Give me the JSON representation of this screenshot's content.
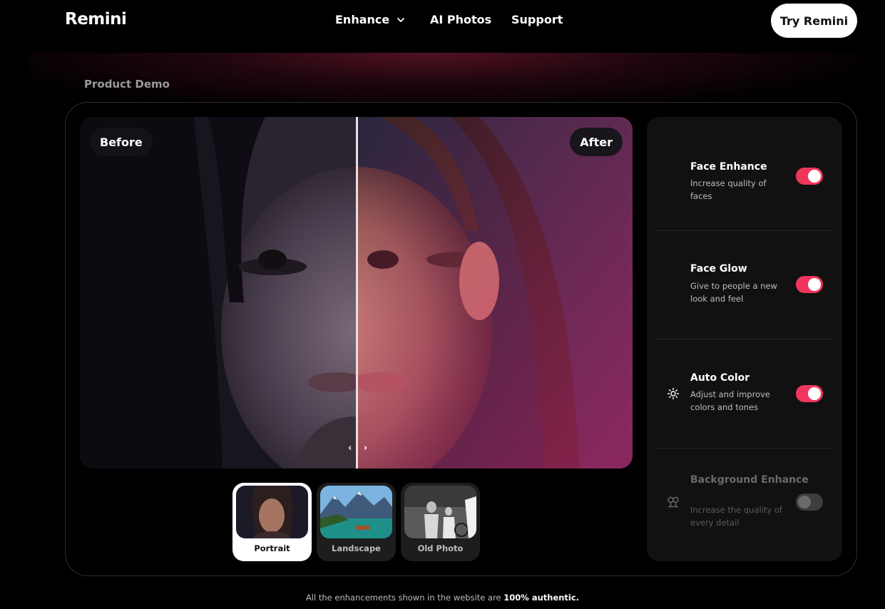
{
  "header": {
    "logo": "Remini",
    "nav": [
      {
        "label": "Enhance",
        "has_dropdown": true
      },
      {
        "label": "AI Photos"
      },
      {
        "label": "Support"
      }
    ],
    "cta": "Try Remini"
  },
  "section_title": "Product Demo",
  "viewer": {
    "before_label": "Before",
    "after_label": "After",
    "handle": "‹ ›"
  },
  "samples": [
    {
      "label": "Portrait",
      "selected": true
    },
    {
      "label": "Landscape",
      "selected": false
    },
    {
      "label": "Old Photo",
      "selected": false
    }
  ],
  "options": [
    {
      "title": "Face Enhance",
      "description": "Increase quality of faces",
      "enabled": true,
      "icon": "face-enhance-icon"
    },
    {
      "title": "Face Glow",
      "description": "Give to people a new look and feel",
      "enabled": true,
      "icon": "face-glow-icon"
    },
    {
      "title": "Auto Color",
      "description": "Adjust and improve colors and tones",
      "enabled": true,
      "icon": "sun-icon"
    },
    {
      "title": "Background Enhance",
      "description": "Increase the quality of every detail",
      "enabled": false,
      "icon": "trees-icon"
    }
  ],
  "footnote": {
    "text": "All the enhancements shown in the website are ",
    "emphasis": "100% authentic."
  },
  "colors": {
    "accent": "#f0365d",
    "background": "#000000",
    "panel": "#111111"
  }
}
